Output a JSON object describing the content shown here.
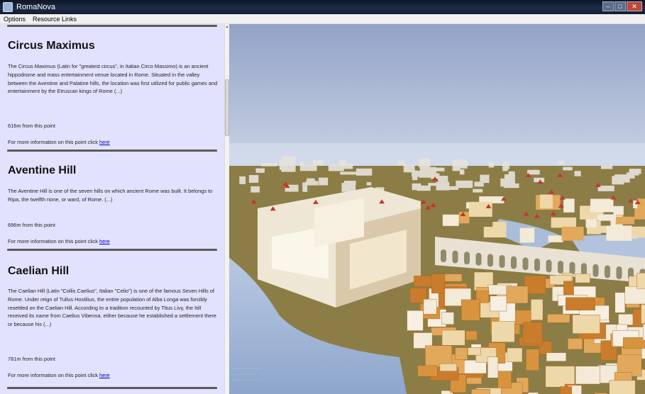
{
  "window": {
    "title": "RomaNova"
  },
  "menu": {
    "items": [
      "Options",
      "Resource Links"
    ]
  },
  "points": [
    {
      "title": "Circus Maximus",
      "description": "The Circus Maximus (Latin for \"greatest circus\", in Italian Circo Massimo) is an ancient hippodrome and mass entertainment venue located in Rome. Situated in the valley between the Aventine and Palatine hills, the location was first utilized for public games and entertainment by the Etruscan kings of Rome (...)",
      "distance": "616m from this point",
      "more_text": "For more information on this point click",
      "link_text": "here"
    },
    {
      "title": "Aventine Hill",
      "description": "The Aventine Hill is one of the seven hills on which ancient Rome was built. It belongs to Ripa, the twelfth rione, or ward, of Rome. (...)",
      "distance": "696m from this point",
      "more_text": "For more information on this point click",
      "link_text": "here"
    },
    {
      "title": "Caelian Hill",
      "description": "The Caelian Hill (Latin \"Collis Caelius\", Italian \"Celio\") is one of the famous Seven Hills of Rome. Under reign of Tullus Hostilius, the entire population of Alba Longa was forcibly resettled on the Caelian Hill. According to a tradition recounted by Titus Livy, the hill received its name from Caelius Vibenna, either because he established a settlement there or because his (...)",
      "distance": "781m from this point",
      "more_text": "For more information on this point click",
      "link_text": "here"
    }
  ],
  "scene": {
    "sky_top": "#93a3c6",
    "sky_bottom": "#c9d3e6",
    "ground": "#8b7d45",
    "water": "#a3b8d8",
    "building_light": "#f3ead8",
    "building_shade": "#d8933e",
    "roof_red": "#c8342a"
  }
}
